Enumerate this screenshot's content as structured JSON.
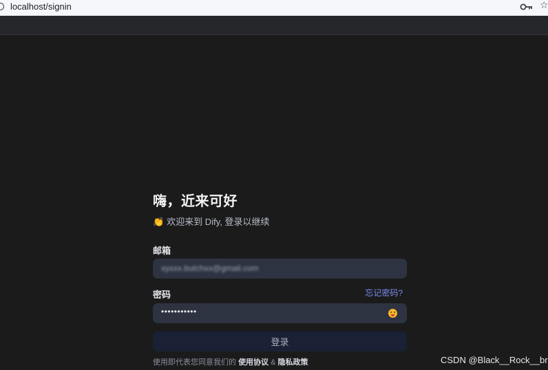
{
  "browser": {
    "url": "localhost/signin"
  },
  "login": {
    "title": "嗨，近来可好",
    "welcome_emoji": "👏",
    "welcome_text": "欢迎来到 Dify, 登录以继续",
    "email_label": "邮箱",
    "email_value": "xyxxx.butchxx@gmail.com",
    "password_label": "密码",
    "forgot_password": "忘记密码?",
    "password_value": "•••••••••••",
    "signin_button": "登录",
    "terms_prefix": "使用即代表您同意我们的",
    "terms_link": "使用协议",
    "terms_and": "&",
    "privacy_link": "隐私政策"
  },
  "watermark": "CSDN @Black__Rock__br"
}
